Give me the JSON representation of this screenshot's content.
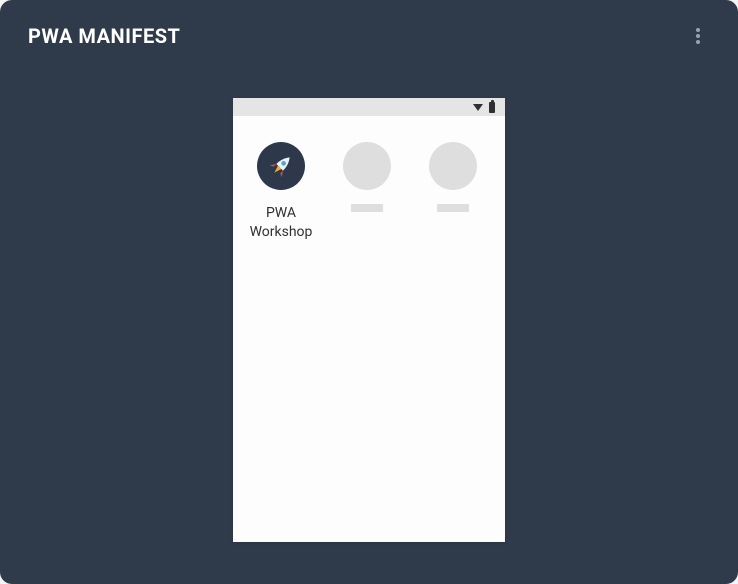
{
  "card": {
    "title": "PWA MANIFEST"
  },
  "apps": [
    {
      "label": "PWA Workshop"
    }
  ]
}
